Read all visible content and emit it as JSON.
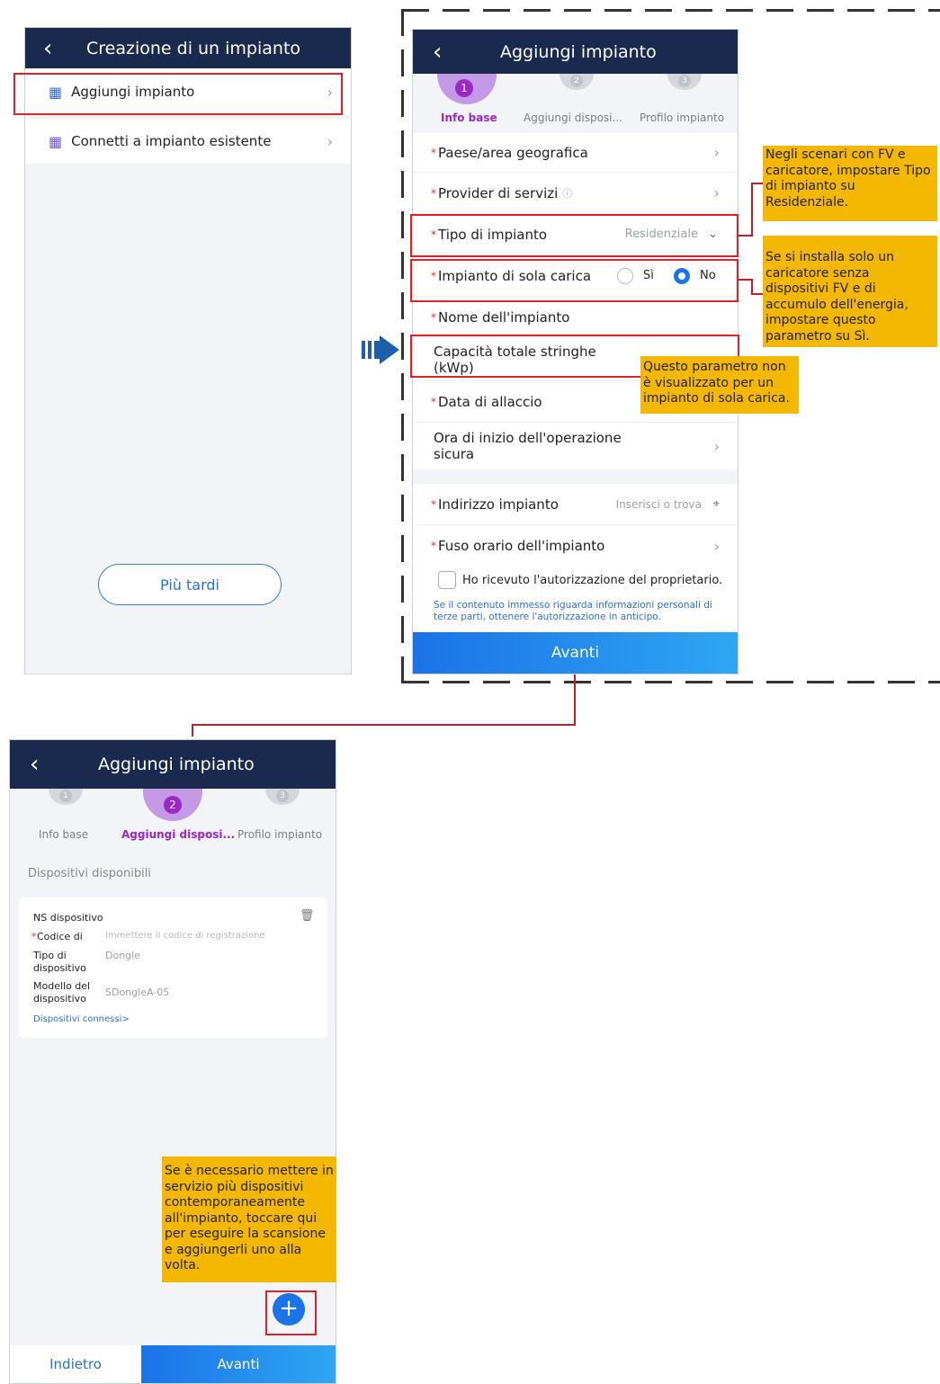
{
  "screen1": {
    "title": "Creazione di un impianto",
    "items": [
      {
        "label": "Aggiungi impianto"
      },
      {
        "label": "Connetti a impianto esistente"
      }
    ],
    "later_button": "Più tardi"
  },
  "screen2": {
    "title": "Aggiungi impianto",
    "steps": [
      {
        "num": "1",
        "label": "Info base"
      },
      {
        "num": "2",
        "label": "Aggiungi disposi..."
      },
      {
        "num": "3",
        "label": "Profilo impianto"
      }
    ],
    "fields": {
      "country": "Paese/area geografica",
      "provider": "Provider di servizi",
      "plant_type": "Tipo di impianto",
      "plant_type_value": "Residenziale",
      "charge_only": "Impianto di sola carica",
      "yes": "Sì",
      "no": "No",
      "plant_name": "Nome dell'impianto",
      "capacity": "Capacità totale stringhe (kWp)",
      "connect_date": "Data di allaccio",
      "safe_start": "Ora di inizio dell'operazione sicura",
      "address": "Indirizzo impianto",
      "address_placeholder": "Inserisci o trova",
      "timezone": "Fuso orario dell'impianto"
    },
    "consent": "Ho ricevuto l'autorizzazione del proprietario.",
    "consent_note": "Se il contenuto immesso riguarda informazioni personali di terze parti, ottenere l'autorizzazione in anticipo.",
    "next_button": "Avanti"
  },
  "screen3": {
    "title": "Aggiungi impianto",
    "steps": [
      {
        "num": "1",
        "label": "Info base"
      },
      {
        "num": "2",
        "label": "Aggiungi disposi..."
      },
      {
        "num": "3",
        "label": "Profilo impianto"
      }
    ],
    "section": "Dispositivi disponibili",
    "card": {
      "sn_label": "NS dispositivo",
      "code_label": "Codice di",
      "code_placeholder": "Immettere il codice di registrazione",
      "type_label": "Tipo di dispositivo",
      "type_value": "Dongle",
      "model_label": "Modello del dispositivo",
      "model_value": "SDongleA-05",
      "link": "Dispositivi connessi>"
    },
    "back_button": "Indietro",
    "next_button": "Avanti"
  },
  "notes": {
    "plant_type": "Negli scenari con FV e caricatore, impostare Tipo di impianto su Residenziale.",
    "charge_only": "Se si installa solo un caricatore senza dispositivi FV e di accumulo dell'energia, impostare questo parametro su Sì.",
    "capacity": "Questo parametro non è visualizzato per un impianto di sola carica.",
    "add_multiple": "Se è necessario mettere in servizio più dispositivi contemporaneamente all'impianto, toccare qui per eseguire la scansione e aggiungerli uno alla volta."
  },
  "colors": {
    "header": "#1a2a4f",
    "accent": "#1a73e8",
    "step_active": "#9b27c9",
    "highlight": "#e0202a",
    "note": "#f5b800"
  }
}
